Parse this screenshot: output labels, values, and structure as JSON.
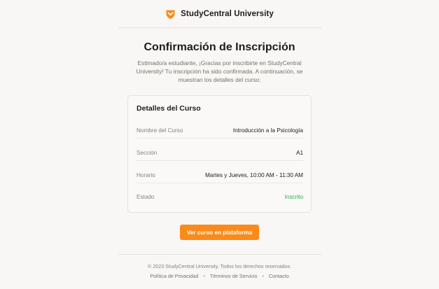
{
  "brand": {
    "name": "StudyCentral University",
    "logo_icon": "shield-chevron-icon",
    "accent_color": "#fb8a1a"
  },
  "email": {
    "title": "Confirmación de Inscripción",
    "intro": "Estimado/a estudiante, ¡Gracias por inscribirte en StudyCentral University! Tu inscripción ha sido confirmada. A continuación, se muestran los detalles del curso:"
  },
  "course_details": {
    "heading": "Detalles del Curso",
    "rows": [
      {
        "label": "Nombre del Curso",
        "value": "Introducción a la Psicología"
      },
      {
        "label": "Sección",
        "value": "A1"
      },
      {
        "label": "Horario",
        "value": "Martes y Jueves, 10:00 AM - 11:30 AM"
      },
      {
        "label": "Estado",
        "value": "Inscrito"
      }
    ],
    "status_color": "#2ea84e"
  },
  "cta": {
    "label": "Ver curso en plataforma"
  },
  "footer": {
    "copyright": "© 2023 StudyCentral University. Todos los derechos reservados.",
    "links": [
      "Política de Privacidad",
      "Términos de Servicio",
      "Contacto"
    ],
    "separator": "•"
  }
}
